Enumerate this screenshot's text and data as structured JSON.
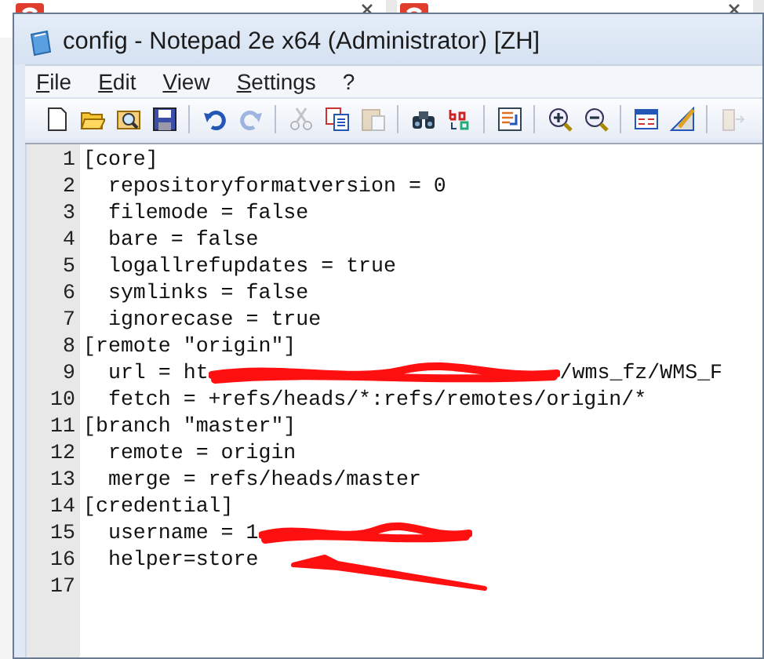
{
  "window": {
    "title": "config - Notepad 2e x64 (Administrator) [ZH]"
  },
  "menu": [
    {
      "label": "File"
    },
    {
      "label": "Edit"
    },
    {
      "label": "View"
    },
    {
      "label": "Settings"
    },
    {
      "label": "?"
    }
  ],
  "toolbar": [
    {
      "kind": "new",
      "disabled": false
    },
    {
      "kind": "open",
      "disabled": false
    },
    {
      "kind": "browse",
      "disabled": false
    },
    {
      "kind": "save",
      "disabled": false
    },
    {
      "kind": "sep"
    },
    {
      "kind": "undo",
      "disabled": false
    },
    {
      "kind": "redo",
      "disabled": true
    },
    {
      "kind": "sep"
    },
    {
      "kind": "cut",
      "disabled": true
    },
    {
      "kind": "copy",
      "disabled": false
    },
    {
      "kind": "paste",
      "disabled": true
    },
    {
      "kind": "sep"
    },
    {
      "kind": "find",
      "disabled": false
    },
    {
      "kind": "replace",
      "disabled": false
    },
    {
      "kind": "sep"
    },
    {
      "kind": "wrap",
      "disabled": false
    },
    {
      "kind": "sep"
    },
    {
      "kind": "zoom-in",
      "disabled": false
    },
    {
      "kind": "zoom-out",
      "disabled": false
    },
    {
      "kind": "sep"
    },
    {
      "kind": "scheme",
      "disabled": false
    },
    {
      "kind": "customize",
      "disabled": false
    },
    {
      "kind": "sep"
    },
    {
      "kind": "exit",
      "disabled": true
    }
  ],
  "editor": {
    "lines": [
      {
        "number": "1",
        "segments": [
          {
            "kind": "text",
            "text": "[core]"
          }
        ]
      },
      {
        "number": "2",
        "segments": [
          {
            "kind": "text",
            "text": "  repositoryformatversion = 0"
          }
        ]
      },
      {
        "number": "3",
        "segments": [
          {
            "kind": "text",
            "text": "  filemode = false"
          }
        ]
      },
      {
        "number": "4",
        "segments": [
          {
            "kind": "text",
            "text": "  bare = false"
          }
        ]
      },
      {
        "number": "5",
        "segments": [
          {
            "kind": "text",
            "text": "  logallrefupdates = true"
          }
        ]
      },
      {
        "number": "6",
        "segments": [
          {
            "kind": "text",
            "text": "  symlinks = false"
          }
        ]
      },
      {
        "number": "7",
        "segments": [
          {
            "kind": "text",
            "text": "  ignorecase = true"
          }
        ]
      },
      {
        "number": "8",
        "segments": [
          {
            "kind": "text",
            "text": "[remote \"origin\"]"
          }
        ]
      },
      {
        "number": "9",
        "segments": [
          {
            "kind": "text",
            "text": "  url = ht"
          },
          {
            "kind": "redaction"
          },
          {
            "kind": "text",
            "text": "/wms_fz/WMS_F"
          }
        ]
      },
      {
        "number": "10",
        "segments": [
          {
            "kind": "text",
            "text": "  fetch = +refs/heads/*:refs/remotes/origin/*"
          }
        ]
      },
      {
        "number": "11",
        "segments": [
          {
            "kind": "text",
            "text": "[branch \"master\"]"
          }
        ]
      },
      {
        "number": "12",
        "segments": [
          {
            "kind": "text",
            "text": "  remote = origin"
          }
        ]
      },
      {
        "number": "13",
        "segments": [
          {
            "kind": "text",
            "text": "  merge = refs/heads/master"
          }
        ]
      },
      {
        "number": "14",
        "segments": [
          {
            "kind": "text",
            "text": "[credential]"
          }
        ]
      },
      {
        "number": "15",
        "segments": [
          {
            "kind": "text",
            "text": "  username = 1"
          },
          {
            "kind": "redaction"
          }
        ]
      },
      {
        "number": "16",
        "segments": [
          {
            "kind": "text",
            "text": "  helper=store"
          }
        ],
        "arrow_marked": true
      },
      {
        "number": "17"
      }
    ]
  }
}
